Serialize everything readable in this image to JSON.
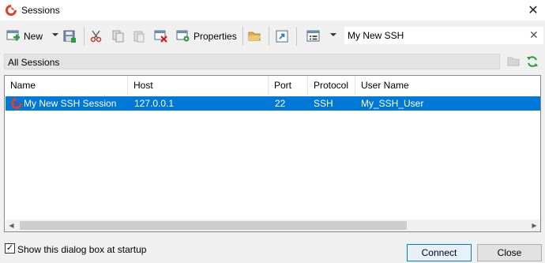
{
  "window": {
    "title": "Sessions",
    "close_glyph": "✕"
  },
  "toolbar": {
    "new_label": "New",
    "properties_label": "Properties",
    "icons": [
      "new-session-icon",
      "save-icon",
      "cut-icon",
      "copy-icon",
      "paste-icon",
      "delete-icon",
      "properties-icon",
      "open-folder-icon",
      "shortcut-icon",
      "view-icon"
    ]
  },
  "search": {
    "value": "My New SSH",
    "clear_glyph": "✕"
  },
  "sessions_header": {
    "label": "All Sessions"
  },
  "table": {
    "columns": [
      "Name",
      "Host",
      "Port",
      "Protocol",
      "User Name"
    ],
    "rows": [
      {
        "name": "My New SSH Session",
        "host": "127.0.0.1",
        "port": "22",
        "protocol": "SSH",
        "user": "My_SSH_User",
        "selected": true
      }
    ]
  },
  "footer": {
    "show_at_startup_label": "Show this dialog box at startup",
    "show_at_startup_checked": true,
    "check_glyph": "✓",
    "connect_label": "Connect",
    "close_label": "Close"
  },
  "colors": {
    "selection": "#0078d7",
    "app_icon": "#e0402a",
    "accent_green": "#2e9b3e"
  }
}
